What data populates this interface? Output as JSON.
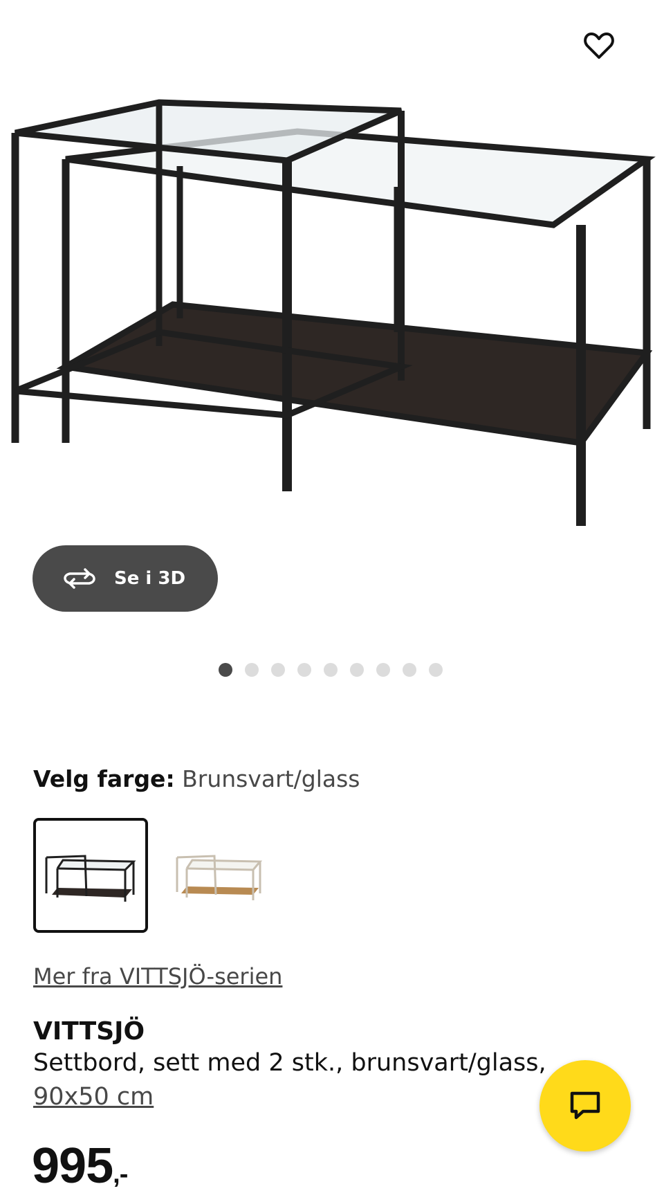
{
  "gallery": {
    "image_alt": "VITTSJÖ settbord",
    "view_3d_label": "Se i 3D",
    "slide_count": 9,
    "active_slide": 1
  },
  "icons": {
    "favorite": "heart-icon",
    "view_3d": "rotate-3d-icon",
    "chat": "chat-bubble-icon"
  },
  "color_picker": {
    "label": "Velg farge:",
    "selected_value": "Brunsvart/glass",
    "options": [
      "black-brown",
      "white-beige"
    ]
  },
  "series_link": "Mer fra VITTSJÖ-serien",
  "product": {
    "name": "VITTSJÖ",
    "description": "Settbord, sett med 2 stk., brunsvart/glass,",
    "size": "90x50 cm",
    "price": "995",
    "price_suffix": ",-"
  },
  "colors": {
    "chat_button": "#ffda1a",
    "dark_button": "#4a4a4a",
    "frame": "#1f1f1f",
    "shelf": "#2e2724"
  }
}
